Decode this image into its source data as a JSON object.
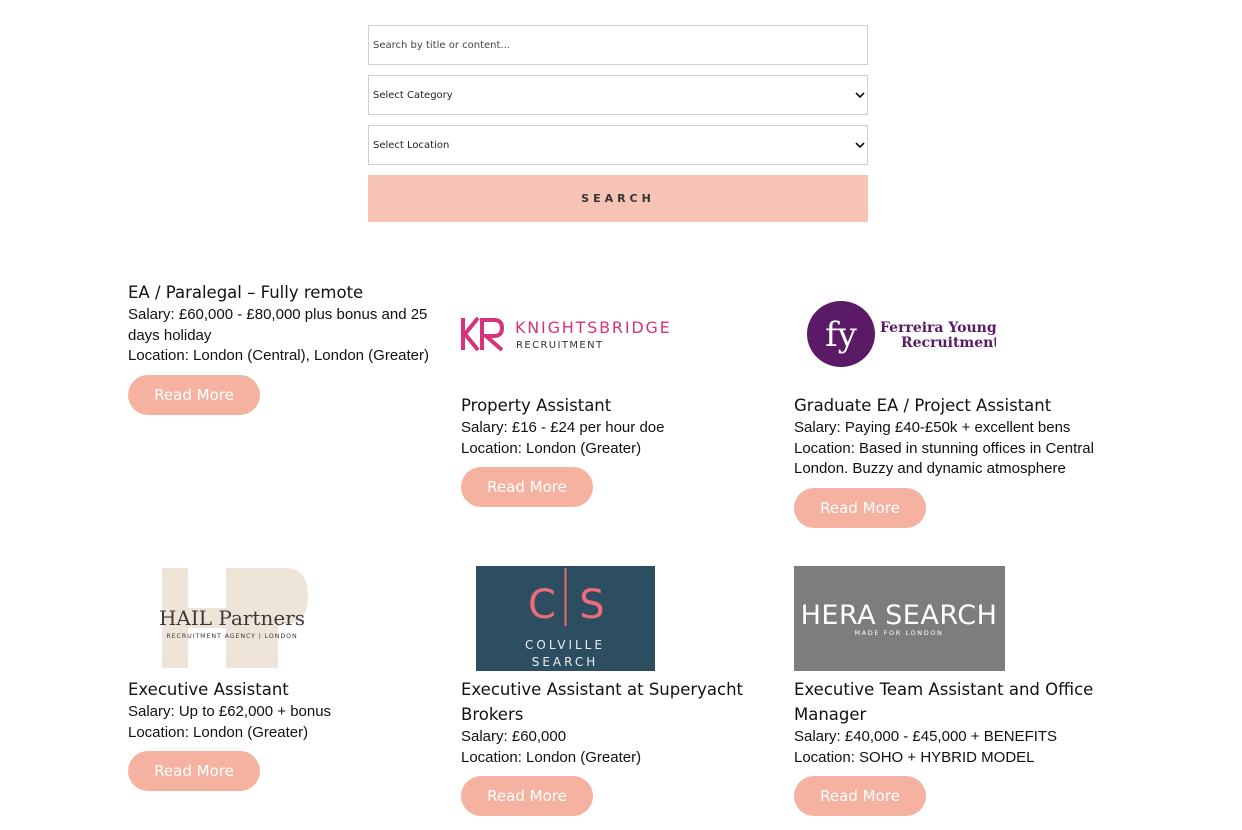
{
  "search": {
    "placeholder": "Search by title or content...",
    "category_selected": "Select Category",
    "location_selected": "Select Location",
    "button_label": "SEARCH"
  },
  "jobs": [
    {
      "title": "EA / Paralegal – Fully remote",
      "salary": "Salary: £60,000 - £80,000 plus bonus and 25 days holiday",
      "location": "Location: London (Central), London (Greater)",
      "cta": "Read More"
    },
    {
      "logo_text": "KNIGHTSBRIDGE",
      "logo_sub": "RECRUITMENT",
      "logo_mark": "KR",
      "title": "Property Assistant",
      "salary": "Salary: £16 - £24 per hour doe",
      "location": "Location: London (Greater)",
      "cta": "Read More"
    },
    {
      "logo_mark": "fy",
      "logo_text": "Ferreira Young",
      "logo_sub": "Recruitment",
      "title": "Graduate EA / Project Assistant",
      "salary": "Salary: Paying £40-£50k + excellent bens",
      "location": "Location: Based in stunning offices in Central London. Buzzy and dynamic atmosphere",
      "cta": "Read More"
    },
    {
      "logo_text": "HAIL Partners",
      "logo_sub": "RECRUITMENT AGENCY | LONDON",
      "title": "Executive Assistant",
      "salary": "Salary: Up to £62,000 + bonus",
      "location": "Location: London (Greater)",
      "cta": "Read More"
    },
    {
      "logo_mark": "C|S",
      "logo_text": "COLVILLE",
      "logo_sub": "SEARCH",
      "title": "Executive Assistant at Superyacht Brokers",
      "salary": "Salary: £60,000",
      "location": "Location: London (Greater)",
      "cta": "Read More"
    },
    {
      "logo_text": "HERA SEARCH",
      "logo_sub": "MADE FOR LONDON",
      "title": "Executive Team Assistant and Office Manager",
      "salary": "Salary: £40,000 - £45,000 + BENEFITS",
      "location": "Location: SOHO + HYBRID MODEL",
      "cta": "Read More"
    }
  ],
  "colors": {
    "button_pink": "#f7c3b5",
    "read_more_pink": "#f5b2a1",
    "knightsbridge_pink": "#d6337a",
    "ferreira_purple": "#5a1a66",
    "colville_teal": "#2d4e60",
    "colville_pink": "#ee6b7c",
    "hera_grey": "#7d7d7d"
  }
}
